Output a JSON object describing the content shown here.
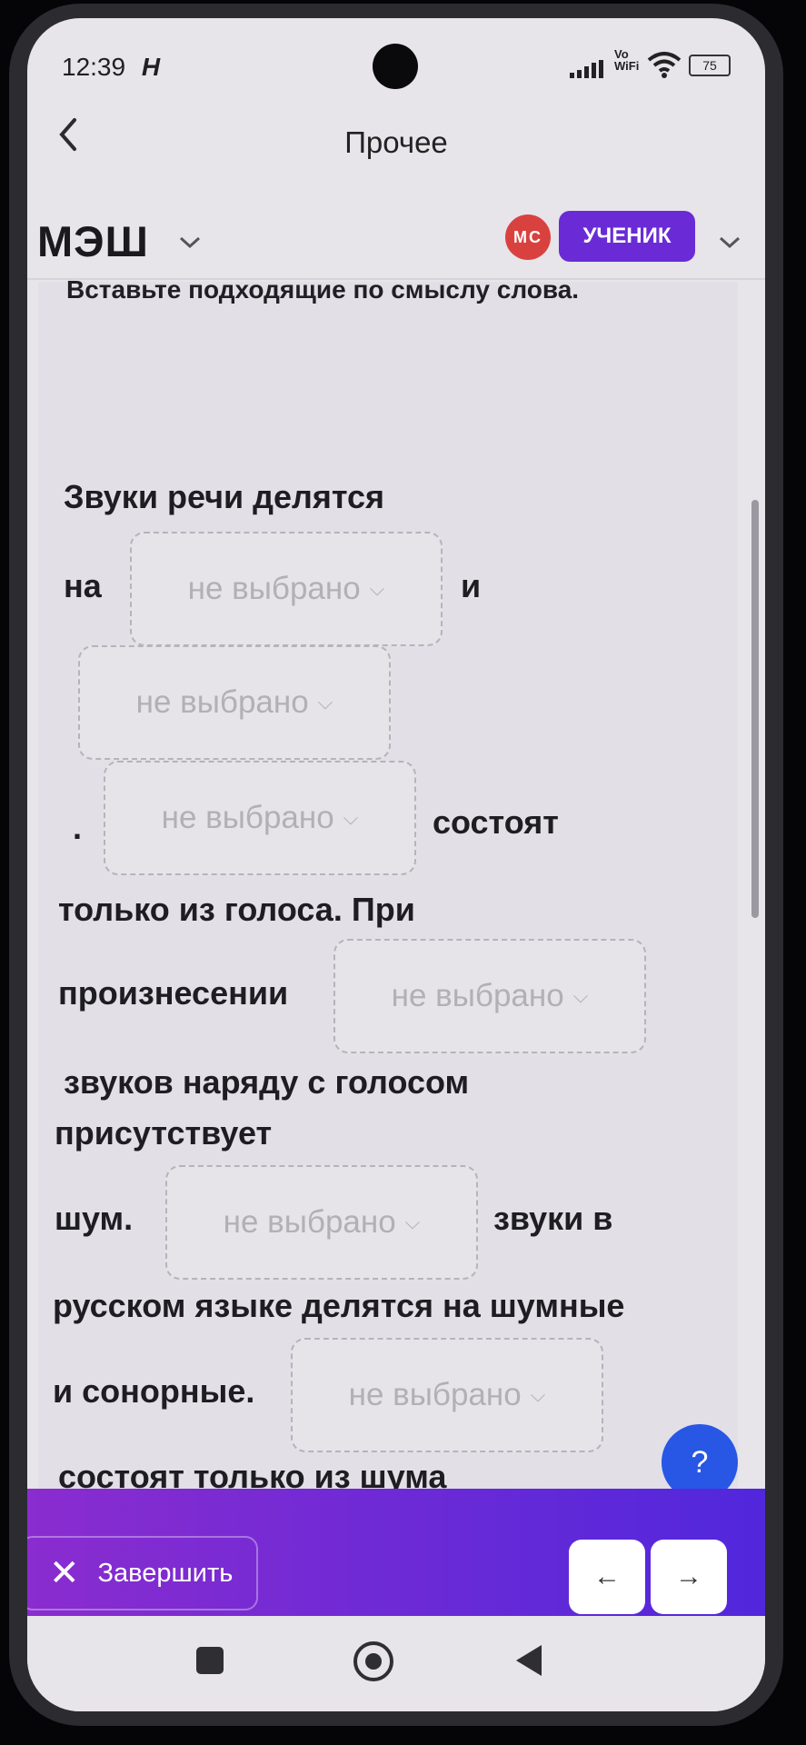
{
  "status_bar": {
    "time": "12:39",
    "carrier_icon": "H",
    "vowifi_top": "Vo",
    "vowifi_bottom": "WiFi",
    "battery": "75"
  },
  "header": {
    "title": "Прочее"
  },
  "brand": {
    "logo": "МЭШ",
    "avatar_initials": "МС",
    "role": "УЧЕНИК"
  },
  "task": {
    "instruction": "Вставьте подходящие по смыслу слова.",
    "text": {
      "t1": "Звуки речи делятся",
      "t2": "на",
      "t3": "и",
      "t4": ".",
      "t5": "состоят",
      "t6": "только из голоса. При",
      "t7": "произнесении",
      "t8": "звуков наряду с голосом",
      "t9": "присутствует",
      "t10": "шум.",
      "t11": "звуки в",
      "t12": "русском языке делятся на шумные",
      "t13": "и сонорные.",
      "t14": "состоят только из шума"
    },
    "dropdowns": [
      "не выбрано",
      "не выбрано",
      "не выбрано",
      "не выбрано",
      "не выбрано",
      "не выбрано"
    ]
  },
  "help_label": "?",
  "footer": {
    "finish_label": "Завершить",
    "prev_label": "←",
    "next_label": "→"
  },
  "colors": {
    "brand_purple": "#6a2bd6",
    "avatar_red": "#d9413f",
    "help_blue": "#2857e6"
  }
}
